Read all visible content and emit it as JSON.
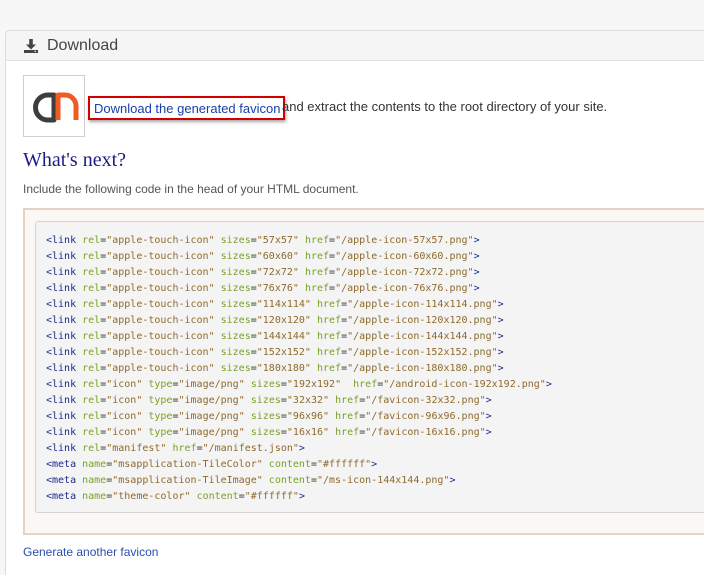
{
  "header": {
    "icon": "download-icon",
    "title": "Download"
  },
  "logo": {
    "icon": "favicon-logo-icon"
  },
  "download": {
    "link_text": "Download the generated favicon",
    "rest_text": "and extract the contents to the root directory of your site."
  },
  "whats_next": {
    "heading": "What's next?",
    "instruction": "Include the following code in the head of your HTML document."
  },
  "code_lines": [
    [
      [
        "tag",
        "<link "
      ],
      [
        "attr",
        "rel"
      ],
      [
        "eq",
        "="
      ],
      [
        "val",
        "\"apple-touch-icon\""
      ],
      [
        "sp",
        " "
      ],
      [
        "attr",
        "sizes"
      ],
      [
        "eq",
        "="
      ],
      [
        "val",
        "\"57x57\""
      ],
      [
        "sp",
        " "
      ],
      [
        "attr",
        "href"
      ],
      [
        "eq",
        "="
      ],
      [
        "val",
        "\"/apple-icon-57x57.png\""
      ],
      [
        "tag",
        ">"
      ]
    ],
    [
      [
        "tag",
        "<link "
      ],
      [
        "attr",
        "rel"
      ],
      [
        "eq",
        "="
      ],
      [
        "val",
        "\"apple-touch-icon\""
      ],
      [
        "sp",
        " "
      ],
      [
        "attr",
        "sizes"
      ],
      [
        "eq",
        "="
      ],
      [
        "val",
        "\"60x60\""
      ],
      [
        "sp",
        " "
      ],
      [
        "attr",
        "href"
      ],
      [
        "eq",
        "="
      ],
      [
        "val",
        "\"/apple-icon-60x60.png\""
      ],
      [
        "tag",
        ">"
      ]
    ],
    [
      [
        "tag",
        "<link "
      ],
      [
        "attr",
        "rel"
      ],
      [
        "eq",
        "="
      ],
      [
        "val",
        "\"apple-touch-icon\""
      ],
      [
        "sp",
        " "
      ],
      [
        "attr",
        "sizes"
      ],
      [
        "eq",
        "="
      ],
      [
        "val",
        "\"72x72\""
      ],
      [
        "sp",
        " "
      ],
      [
        "attr",
        "href"
      ],
      [
        "eq",
        "="
      ],
      [
        "val",
        "\"/apple-icon-72x72.png\""
      ],
      [
        "tag",
        ">"
      ]
    ],
    [
      [
        "tag",
        "<link "
      ],
      [
        "attr",
        "rel"
      ],
      [
        "eq",
        "="
      ],
      [
        "val",
        "\"apple-touch-icon\""
      ],
      [
        "sp",
        " "
      ],
      [
        "attr",
        "sizes"
      ],
      [
        "eq",
        "="
      ],
      [
        "val",
        "\"76x76\""
      ],
      [
        "sp",
        " "
      ],
      [
        "attr",
        "href"
      ],
      [
        "eq",
        "="
      ],
      [
        "val",
        "\"/apple-icon-76x76.png\""
      ],
      [
        "tag",
        ">"
      ]
    ],
    [
      [
        "tag",
        "<link "
      ],
      [
        "attr",
        "rel"
      ],
      [
        "eq",
        "="
      ],
      [
        "val",
        "\"apple-touch-icon\""
      ],
      [
        "sp",
        " "
      ],
      [
        "attr",
        "sizes"
      ],
      [
        "eq",
        "="
      ],
      [
        "val",
        "\"114x114\""
      ],
      [
        "sp",
        " "
      ],
      [
        "attr",
        "href"
      ],
      [
        "eq",
        "="
      ],
      [
        "val",
        "\"/apple-icon-114x114.png\""
      ],
      [
        "tag",
        ">"
      ]
    ],
    [
      [
        "tag",
        "<link "
      ],
      [
        "attr",
        "rel"
      ],
      [
        "eq",
        "="
      ],
      [
        "val",
        "\"apple-touch-icon\""
      ],
      [
        "sp",
        " "
      ],
      [
        "attr",
        "sizes"
      ],
      [
        "eq",
        "="
      ],
      [
        "val",
        "\"120x120\""
      ],
      [
        "sp",
        " "
      ],
      [
        "attr",
        "href"
      ],
      [
        "eq",
        "="
      ],
      [
        "val",
        "\"/apple-icon-120x120.png\""
      ],
      [
        "tag",
        ">"
      ]
    ],
    [
      [
        "tag",
        "<link "
      ],
      [
        "attr",
        "rel"
      ],
      [
        "eq",
        "="
      ],
      [
        "val",
        "\"apple-touch-icon\""
      ],
      [
        "sp",
        " "
      ],
      [
        "attr",
        "sizes"
      ],
      [
        "eq",
        "="
      ],
      [
        "val",
        "\"144x144\""
      ],
      [
        "sp",
        " "
      ],
      [
        "attr",
        "href"
      ],
      [
        "eq",
        "="
      ],
      [
        "val",
        "\"/apple-icon-144x144.png\""
      ],
      [
        "tag",
        ">"
      ]
    ],
    [
      [
        "tag",
        "<link "
      ],
      [
        "attr",
        "rel"
      ],
      [
        "eq",
        "="
      ],
      [
        "val",
        "\"apple-touch-icon\""
      ],
      [
        "sp",
        " "
      ],
      [
        "attr",
        "sizes"
      ],
      [
        "eq",
        "="
      ],
      [
        "val",
        "\"152x152\""
      ],
      [
        "sp",
        " "
      ],
      [
        "attr",
        "href"
      ],
      [
        "eq",
        "="
      ],
      [
        "val",
        "\"/apple-icon-152x152.png\""
      ],
      [
        "tag",
        ">"
      ]
    ],
    [
      [
        "tag",
        "<link "
      ],
      [
        "attr",
        "rel"
      ],
      [
        "eq",
        "="
      ],
      [
        "val",
        "\"apple-touch-icon\""
      ],
      [
        "sp",
        " "
      ],
      [
        "attr",
        "sizes"
      ],
      [
        "eq",
        "="
      ],
      [
        "val",
        "\"180x180\""
      ],
      [
        "sp",
        " "
      ],
      [
        "attr",
        "href"
      ],
      [
        "eq",
        "="
      ],
      [
        "val",
        "\"/apple-icon-180x180.png\""
      ],
      [
        "tag",
        ">"
      ]
    ],
    [
      [
        "tag",
        "<link "
      ],
      [
        "attr",
        "rel"
      ],
      [
        "eq",
        "="
      ],
      [
        "val",
        "\"icon\""
      ],
      [
        "sp",
        " "
      ],
      [
        "attr",
        "type"
      ],
      [
        "eq",
        "="
      ],
      [
        "val",
        "\"image/png\""
      ],
      [
        "sp",
        " "
      ],
      [
        "attr",
        "sizes"
      ],
      [
        "eq",
        "="
      ],
      [
        "val",
        "\"192x192\""
      ],
      [
        "sp",
        "  "
      ],
      [
        "attr",
        "href"
      ],
      [
        "eq",
        "="
      ],
      [
        "val",
        "\"/android-icon-192x192.png\""
      ],
      [
        "tag",
        ">"
      ]
    ],
    [
      [
        "tag",
        "<link "
      ],
      [
        "attr",
        "rel"
      ],
      [
        "eq",
        "="
      ],
      [
        "val",
        "\"icon\""
      ],
      [
        "sp",
        " "
      ],
      [
        "attr",
        "type"
      ],
      [
        "eq",
        "="
      ],
      [
        "val",
        "\"image/png\""
      ],
      [
        "sp",
        " "
      ],
      [
        "attr",
        "sizes"
      ],
      [
        "eq",
        "="
      ],
      [
        "val",
        "\"32x32\""
      ],
      [
        "sp",
        " "
      ],
      [
        "attr",
        "href"
      ],
      [
        "eq",
        "="
      ],
      [
        "val",
        "\"/favicon-32x32.png\""
      ],
      [
        "tag",
        ">"
      ]
    ],
    [
      [
        "tag",
        "<link "
      ],
      [
        "attr",
        "rel"
      ],
      [
        "eq",
        "="
      ],
      [
        "val",
        "\"icon\""
      ],
      [
        "sp",
        " "
      ],
      [
        "attr",
        "type"
      ],
      [
        "eq",
        "="
      ],
      [
        "val",
        "\"image/png\""
      ],
      [
        "sp",
        " "
      ],
      [
        "attr",
        "sizes"
      ],
      [
        "eq",
        "="
      ],
      [
        "val",
        "\"96x96\""
      ],
      [
        "sp",
        " "
      ],
      [
        "attr",
        "href"
      ],
      [
        "eq",
        "="
      ],
      [
        "val",
        "\"/favicon-96x96.png\""
      ],
      [
        "tag",
        ">"
      ]
    ],
    [
      [
        "tag",
        "<link "
      ],
      [
        "attr",
        "rel"
      ],
      [
        "eq",
        "="
      ],
      [
        "val",
        "\"icon\""
      ],
      [
        "sp",
        " "
      ],
      [
        "attr",
        "type"
      ],
      [
        "eq",
        "="
      ],
      [
        "val",
        "\"image/png\""
      ],
      [
        "sp",
        " "
      ],
      [
        "attr",
        "sizes"
      ],
      [
        "eq",
        "="
      ],
      [
        "val",
        "\"16x16\""
      ],
      [
        "sp",
        " "
      ],
      [
        "attr",
        "href"
      ],
      [
        "eq",
        "="
      ],
      [
        "val",
        "\"/favicon-16x16.png\""
      ],
      [
        "tag",
        ">"
      ]
    ],
    [
      [
        "tag",
        "<link "
      ],
      [
        "attr",
        "rel"
      ],
      [
        "eq",
        "="
      ],
      [
        "val",
        "\"manifest\""
      ],
      [
        "sp",
        " "
      ],
      [
        "attr",
        "href"
      ],
      [
        "eq",
        "="
      ],
      [
        "val",
        "\"/manifest.json\""
      ],
      [
        "tag",
        ">"
      ]
    ],
    [
      [
        "tag",
        "<meta "
      ],
      [
        "attr",
        "name"
      ],
      [
        "eq",
        "="
      ],
      [
        "val",
        "\"msapplication-TileColor\""
      ],
      [
        "sp",
        " "
      ],
      [
        "attr",
        "content"
      ],
      [
        "eq",
        "="
      ],
      [
        "val",
        "\"#ffffff\""
      ],
      [
        "tag",
        ">"
      ]
    ],
    [
      [
        "tag",
        "<meta "
      ],
      [
        "attr",
        "name"
      ],
      [
        "eq",
        "="
      ],
      [
        "val",
        "\"msapplication-TileImage\""
      ],
      [
        "sp",
        " "
      ],
      [
        "attr",
        "content"
      ],
      [
        "eq",
        "="
      ],
      [
        "val",
        "\"/ms-icon-144x144.png\""
      ],
      [
        "tag",
        ">"
      ]
    ],
    [
      [
        "tag",
        "<meta "
      ],
      [
        "attr",
        "name"
      ],
      [
        "eq",
        "="
      ],
      [
        "val",
        "\"theme-color\""
      ],
      [
        "sp",
        " "
      ],
      [
        "attr",
        "content"
      ],
      [
        "eq",
        "="
      ],
      [
        "val",
        "\"#ffffff\""
      ],
      [
        "tag",
        ">"
      ]
    ]
  ],
  "footer": {
    "generate_another": "Generate another favicon"
  },
  "colors": {
    "link": "#1a3ea8",
    "highlight_border": "#d30000",
    "heading": "#1d1b84",
    "code_tag": "#1d2a8f",
    "code_attr": "#7aa127",
    "code_value": "#8d6a2d",
    "logo_dark": "#3d3d3d",
    "logo_orange": "#f15a22"
  }
}
